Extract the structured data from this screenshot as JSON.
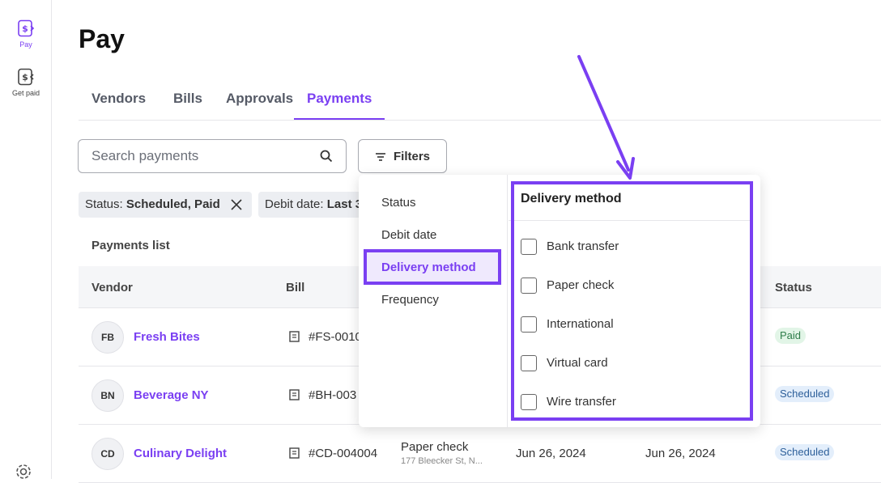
{
  "sidebar": {
    "items": [
      {
        "label": "Pay",
        "icon": "pay-icon",
        "active": true
      },
      {
        "label": "Get paid",
        "icon": "get-paid-icon",
        "active": false
      }
    ],
    "settings_icon": "gear-icon"
  },
  "page": {
    "title": "Pay"
  },
  "tabs": [
    {
      "label": "Vendors"
    },
    {
      "label": "Bills"
    },
    {
      "label": "Approvals"
    },
    {
      "label": "Payments",
      "active": true
    }
  ],
  "search": {
    "placeholder": "Search payments",
    "value": ""
  },
  "filters": {
    "label": "Filters"
  },
  "chips": [
    {
      "key": "Status:",
      "value": "Scheduled, Paid"
    },
    {
      "key": "Debit date:",
      "value": "Last 3"
    }
  ],
  "list": {
    "title": "Payments list",
    "columns": [
      "Vendor",
      "Bill",
      "Status"
    ],
    "rows": [
      {
        "initials": "FB",
        "vendor": "Fresh Bites",
        "bill": "#FS-0010",
        "status": "Paid"
      },
      {
        "initials": "BN",
        "vendor": "Beverage NY",
        "bill": "#BH-003",
        "status": "Scheduled"
      },
      {
        "initials": "CD",
        "vendor": "Culinary Delight",
        "bill": "#CD-004004",
        "method": "Paper check",
        "address": "177 Bleecker St, N...",
        "debit_date": "Jun 26, 2024",
        "delivery_date": "Jun 26, 2024",
        "status": "Scheduled"
      }
    ]
  },
  "dropdown": {
    "categories": [
      "Status",
      "Debit date",
      "Delivery method",
      "Frequency"
    ],
    "active_category": "Delivery method",
    "panel_title": "Delivery method",
    "options": [
      "Bank transfer",
      "Paper check",
      "International",
      "Virtual card",
      "Wire transfer"
    ]
  },
  "colors": {
    "accent": "#7a3ff2",
    "paid_bg": "#e2f5e7",
    "scheduled_bg": "#e3eefb"
  }
}
